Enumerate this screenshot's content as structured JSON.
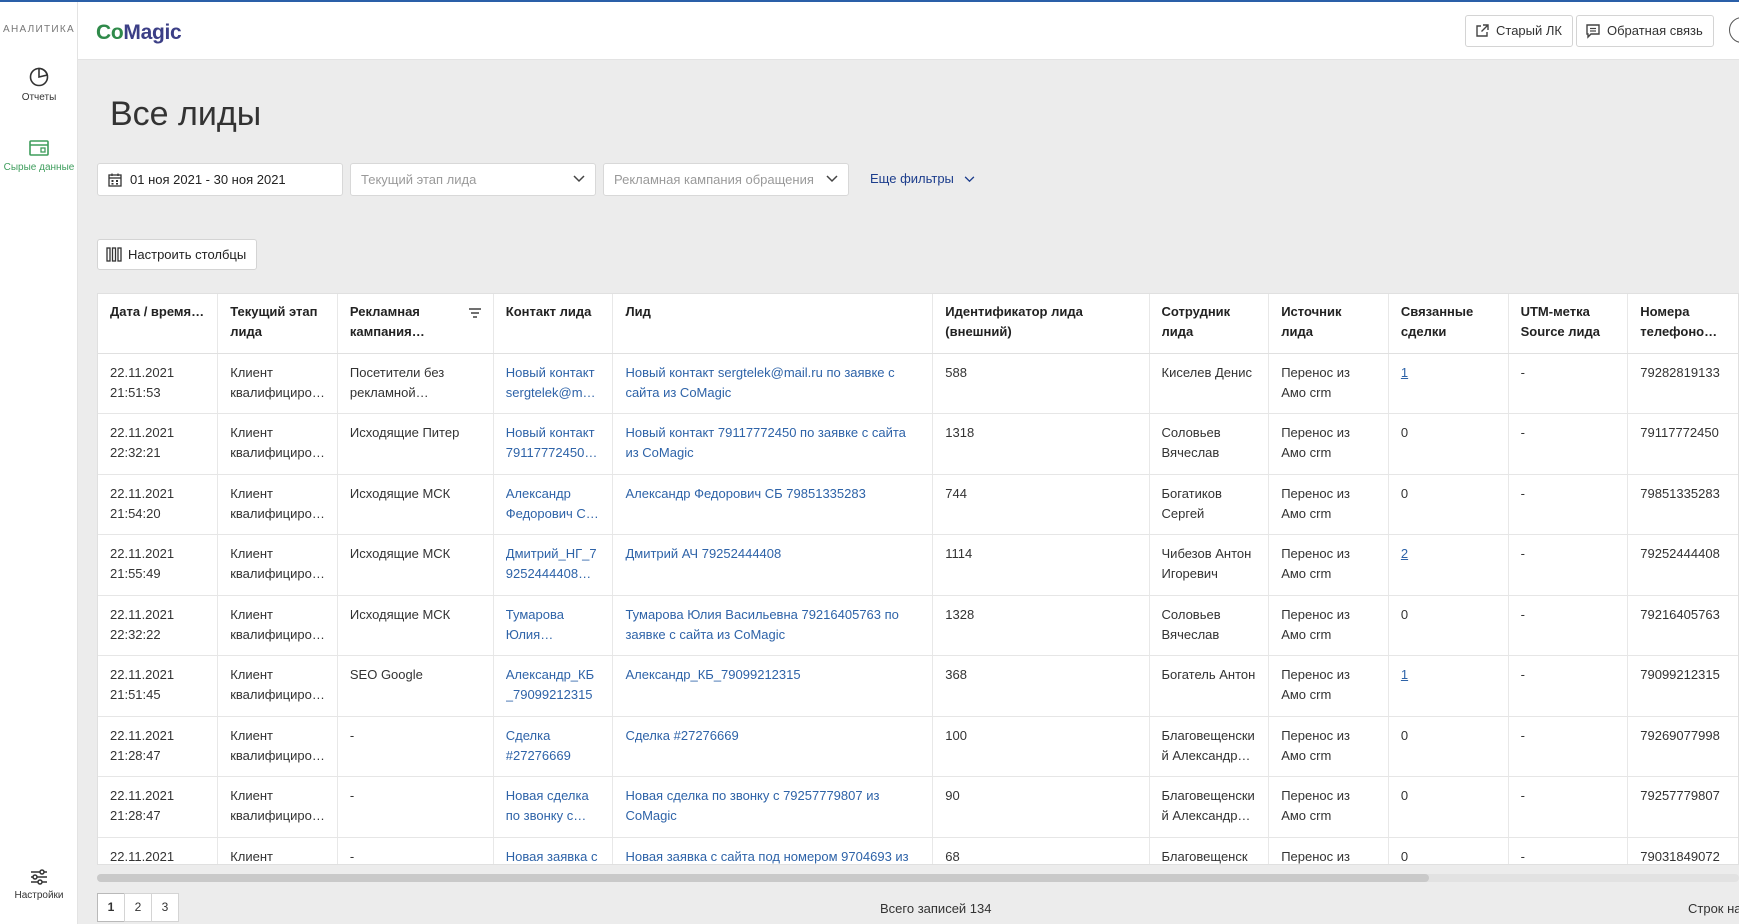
{
  "sidebar": {
    "brand": "АНАЛИТИКА",
    "items": [
      {
        "label": "Отчеты",
        "icon": "reports-pie-icon"
      },
      {
        "label": "Сырые данные",
        "icon": "raw-data-icon",
        "active": true
      },
      {
        "label": "Настройки",
        "icon": "settings-sliders-icon"
      }
    ]
  },
  "header": {
    "logo_part1": "Co",
    "logo_part2": "Magic",
    "old_lk": "Старый ЛК",
    "feedback": "Обратная связь"
  },
  "page": {
    "title": "Все лиды"
  },
  "filters": {
    "date_range": "01 ноя 2021 - 30 ноя 2021",
    "stage_placeholder": "Текущий этап лида",
    "campaign_placeholder": "Рекламная кампания обращения",
    "more_filters": "Еще фильтры"
  },
  "configure_columns": "Настроить столбцы",
  "table": {
    "columns": [
      "Дата / время…",
      "Текущий этап лида",
      "Рекламная кампания…",
      "Контакт лида",
      "Лид",
      "Идентификатор лида (внешний)",
      "Сотрудник лида",
      "Источник лида",
      "Связанные сделки",
      "UTM-метка Source лида",
      "Номера телефоно…"
    ],
    "rows": [
      {
        "date": "22.11.2021 21:51:53",
        "stage": "Клиент квалифициро…",
        "campaign": "Посетители без рекламной…",
        "contact": "Новый контакт sergtelek@mai…",
        "lead": "Новый контакт sergtelek@mail.ru по заявке с сайта из CoMagic",
        "ext_id": "588",
        "employee": "Киселев Денис",
        "source": "Перенос из Амо crm",
        "deals": "1",
        "utm": "-",
        "phones": "79282819133"
      },
      {
        "date": "22.11.2021 22:32:21",
        "stage": "Клиент квалифициро…",
        "campaign": "Исходящие Питер",
        "contact": "Новый контакт 79117772450…",
        "lead": "Новый контакт 79117772450 по заявке с сайта из CoMagic",
        "ext_id": "1318",
        "employee": "Соловьев Вячеслав",
        "source": "Перенос из Амо crm",
        "deals": "0",
        "utm": "-",
        "phones": "79117772450"
      },
      {
        "date": "22.11.2021 21:54:20",
        "stage": "Клиент квалифициро…",
        "campaign": "Исходящие МСК",
        "contact": "Александр Федорович С…",
        "lead": "Александр Федорович СБ 79851335283",
        "ext_id": "744",
        "employee": "Богатиков Сергей",
        "source": "Перенос из Амо crm",
        "deals": "0",
        "utm": "-",
        "phones": "79851335283"
      },
      {
        "date": "22.11.2021 21:55:49",
        "stage": "Клиент квалифициро…",
        "campaign": "Исходящие МСК",
        "contact": "Дмитрий_НГ_79252444408 и…",
        "lead": "Дмитрий АЧ 79252444408",
        "ext_id": "1114",
        "employee": "Чибезов Антон Игоревич",
        "source": "Перенос из Амо crm",
        "deals": "2",
        "utm": "-",
        "phones": "79252444408"
      },
      {
        "date": "22.11.2021 22:32:22",
        "stage": "Клиент квалифициро…",
        "campaign": "Исходящие МСК",
        "contact": "Тумарова Юлия…",
        "lead": "Тумарова Юлия Васильевна 79216405763 по заявке с сайта из CoMagic",
        "ext_id": "1328",
        "employee": "Соловьев Вячеслав",
        "source": "Перенос из Амо crm",
        "deals": "0",
        "utm": "-",
        "phones": "79216405763"
      },
      {
        "date": "22.11.2021 21:51:45",
        "stage": "Клиент квалифициро…",
        "campaign": "SEO Google",
        "contact": "Александр_КБ_79099212315",
        "lead": "Александр_КБ_79099212315",
        "ext_id": "368",
        "employee": "Богатель Антон",
        "source": "Перенос из Амо crm",
        "deals": "1",
        "utm": "-",
        "phones": "79099212315"
      },
      {
        "date": "22.11.2021 21:28:47",
        "stage": "Клиент квалифициро…",
        "campaign": "-",
        "contact": "Сделка #27276669",
        "lead": "Сделка #27276669",
        "ext_id": "100",
        "employee": "Благовещенский Александр…",
        "source": "Перенос из Амо crm",
        "deals": "0",
        "utm": "-",
        "phones": "79269077998"
      },
      {
        "date": "22.11.2021 21:28:47",
        "stage": "Клиент квалифициро…",
        "campaign": "-",
        "contact": "Новая сделка по звонку с…",
        "lead": "Новая сделка по звонку с 79257779807 из CoMagic",
        "ext_id": "90",
        "employee": "Благовещенский Александр…",
        "source": "Перенос из Амо crm",
        "deals": "0",
        "utm": "-",
        "phones": "79257779807"
      },
      {
        "date": "22.11.2021",
        "stage": "Клиент",
        "campaign": "-",
        "contact": "Новая заявка с",
        "lead": "Новая заявка с сайта под номером 9704693 из",
        "ext_id": "68",
        "employee": "Благовещенск",
        "source": "Перенос из",
        "deals": "0",
        "utm": "-",
        "phones": "79031849072"
      }
    ]
  },
  "pagination": {
    "pages": [
      "1",
      "2",
      "3"
    ],
    "active": "1"
  },
  "footer": {
    "total": "Всего записей 134",
    "rows_per_page": "Строк на"
  },
  "colors": {
    "brand_green": "#2f8a4a",
    "brand_purple": "#3c3f86",
    "link_blue": "#2e63a8",
    "filters_link": "#1c3d8c"
  }
}
